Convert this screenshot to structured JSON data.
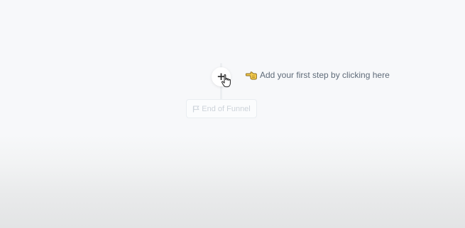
{
  "funnel": {
    "add_step_icon": "plus-icon",
    "cursor_icon": "hand-cursor-icon",
    "hint": {
      "icon": "pointing-left-hand-icon",
      "text": "Add your first step by clicking here"
    },
    "end_node": {
      "icon": "flag-icon",
      "label": "End of Funnel"
    }
  },
  "colors": {
    "hint_text": "#5f6b79",
    "end_label": "#cdd3da",
    "hand_emoji": "#f2c94c"
  }
}
